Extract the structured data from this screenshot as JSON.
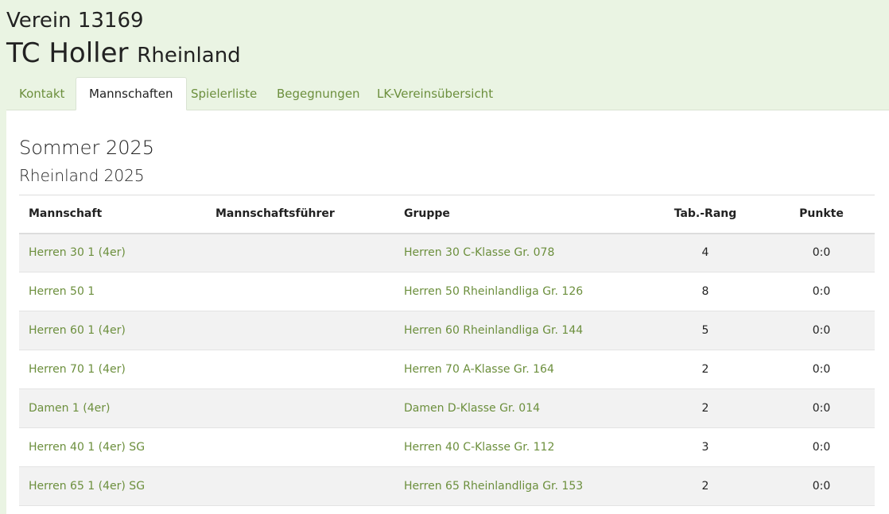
{
  "club": {
    "number_label": "Verein 13169",
    "name": "TC Holler",
    "region": "Rheinland"
  },
  "tabs": [
    {
      "label": "Kontakt",
      "active": false
    },
    {
      "label": "Mannschaften",
      "active": true
    },
    {
      "label": "Spielerliste",
      "active": false
    },
    {
      "label": "Begegnungen",
      "active": false
    },
    {
      "label": "LK-Vereinsübersicht",
      "active": false
    }
  ],
  "content": {
    "season_title": "Sommer 2025",
    "league_title": "Rheinland 2025",
    "columns": {
      "team": "Mannschaft",
      "captain": "Mannschaftsführer",
      "group": "Gruppe",
      "rank": "Tab.-Rang",
      "points": "Punkte"
    },
    "rows": [
      {
        "team": "Herren 30 1 (4er)",
        "captain": "",
        "group": "Herren 30 C-Klasse Gr. 078",
        "rank": "4",
        "points": "0:0"
      },
      {
        "team": "Herren 50 1",
        "captain": "",
        "group": "Herren 50 Rheinlandliga Gr. 126",
        "rank": "8",
        "points": "0:0"
      },
      {
        "team": "Herren 60 1 (4er)",
        "captain": "",
        "group": "Herren 60 Rheinlandliga Gr. 144",
        "rank": "5",
        "points": "0:0"
      },
      {
        "team": "Herren 70 1 (4er)",
        "captain": "",
        "group": "Herren 70 A-Klasse Gr. 164",
        "rank": "2",
        "points": "0:0"
      },
      {
        "team": "Damen 1 (4er)",
        "captain": "",
        "group": "Damen D-Klasse Gr. 014",
        "rank": "2",
        "points": "0:0"
      },
      {
        "team": "Herren 40 1 (4er) SG",
        "captain": "",
        "group": "Herren 40 C-Klasse Gr. 112",
        "rank": "3",
        "points": "0:0"
      },
      {
        "team": "Herren 65 1 (4er) SG",
        "captain": "",
        "group": "Herren 65 Rheinlandliga Gr. 153",
        "rank": "2",
        "points": "0:0"
      }
    ]
  },
  "colors": {
    "header_bg": "#eaf4e3",
    "link": "#6c8f3d",
    "row_stripe": "#f2f2f2"
  }
}
